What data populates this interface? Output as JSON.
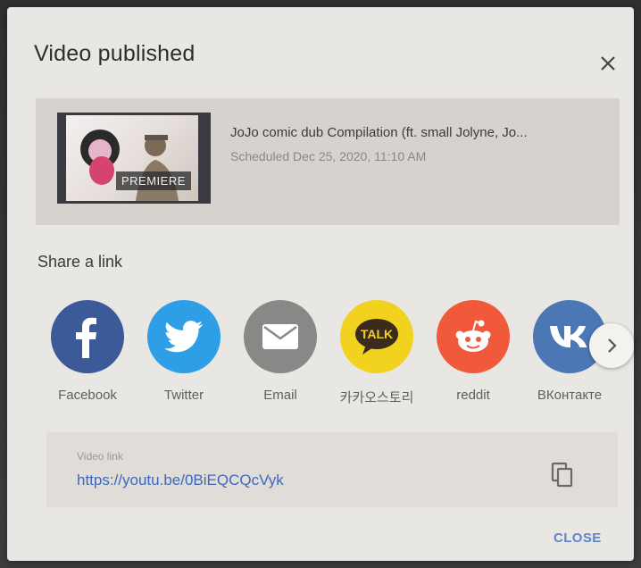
{
  "dialog": {
    "title": "Video published",
    "close_icon": "close-icon"
  },
  "video": {
    "title": "JoJo comic dub Compilation (ft. small Jolyne, Jo...",
    "scheduled": "Scheduled Dec 25, 2020, 11:10 AM",
    "badge": "PREMIERE"
  },
  "share": {
    "title": "Share a link",
    "items": [
      {
        "label": "Facebook",
        "icon": "facebook-icon",
        "color": "#3d5a98"
      },
      {
        "label": "Twitter",
        "icon": "twitter-icon",
        "color": "#2e9fe6"
      },
      {
        "label": "Email",
        "icon": "email-icon",
        "color": "#8a8886"
      },
      {
        "label": "카카오스토리",
        "icon": "kakaotalk-icon",
        "color": "#f1d21e"
      },
      {
        "label": "reddit",
        "icon": "reddit-icon",
        "color": "#f05a3a"
      },
      {
        "label": "ВКонтакте",
        "icon": "vk-icon",
        "color": "#4b77b5"
      }
    ],
    "next_icon": "chevron-right-icon"
  },
  "link": {
    "caption": "Video link",
    "url": "https://youtu.be/0BiEQCQcVyk",
    "copy_icon": "copy-icon"
  },
  "footer": {
    "close_label": "CLOSE"
  }
}
